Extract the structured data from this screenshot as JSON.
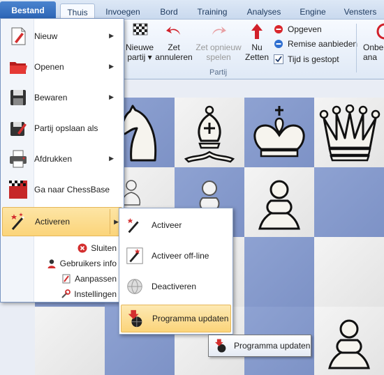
{
  "tabs": {
    "file": "Bestand",
    "items": [
      "Thuis",
      "Invoegen",
      "Bord",
      "Training",
      "Analyses",
      "Engine",
      "Vensters"
    ],
    "active": "Thuis"
  },
  "ribbon": {
    "buttons": [
      {
        "label1": "Nieuwe",
        "label2": "partij ▾"
      },
      {
        "label1": "Zet",
        "label2": "annuleren"
      },
      {
        "label1": "Zet opnieuw",
        "label2": "spelen"
      },
      {
        "label1": "Nu",
        "label2": "Zetten"
      }
    ],
    "small": {
      "resign": "Opgeven",
      "draw": "Remise aanbieden",
      "time_stopped": "Tijd is gestopt"
    },
    "group_label": "Partij",
    "cut_label1": "Onbe",
    "cut_label2": "ana"
  },
  "file_menu": {
    "items": [
      {
        "label": "Nieuw",
        "has_submenu": true
      },
      {
        "label": "Openen",
        "has_submenu": true
      },
      {
        "label": "Bewaren",
        "has_submenu": true
      },
      {
        "label": "Partij opslaan als",
        "has_submenu": false
      },
      {
        "label": "Afdrukken",
        "has_submenu": true
      },
      {
        "label": "Ga naar ChessBase",
        "has_submenu": false
      },
      {
        "label": "Activeren",
        "has_submenu": true
      }
    ],
    "bottom": [
      "Sluiten",
      "Gebruikers info",
      "Aanpassen",
      "Instellingen"
    ]
  },
  "submenu": {
    "items": [
      "Activeer",
      "Activeer off-line",
      "Deactiveren",
      "Programma updaten"
    ]
  },
  "tooltip": {
    "text": "Programma updaten"
  },
  "colors": {
    "file_tab": "#2a63b5",
    "highlight": "#fbd47a",
    "board_dark": "#8ea2d2",
    "board_light": "#f0f0f0"
  }
}
